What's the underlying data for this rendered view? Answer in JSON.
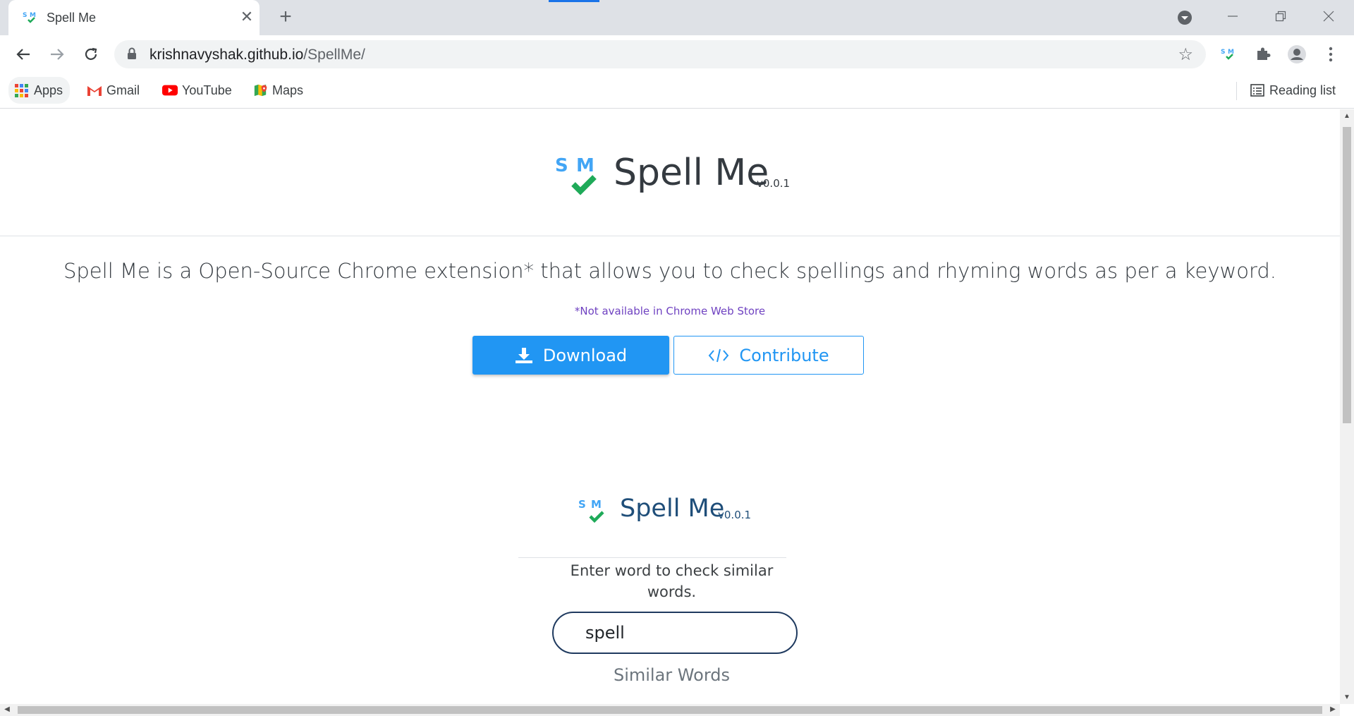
{
  "browser": {
    "tab_title": "Spell Me",
    "tab_close": "✕",
    "new_tab": "+",
    "url_domain": "krishnavyshak.github.io",
    "url_path": "/SpellMe/",
    "bookmarks": [
      {
        "label": "Apps",
        "icon": "apps-grid-icon"
      },
      {
        "label": "Gmail",
        "icon": "gmail-icon"
      },
      {
        "label": "YouTube",
        "icon": "youtube-icon"
      },
      {
        "label": "Maps",
        "icon": "maps-icon"
      }
    ],
    "reading_list": "Reading list"
  },
  "hero": {
    "logo_letters": "SM",
    "title": "Spell Me",
    "version": "v0.0.1"
  },
  "content": {
    "lead": "Spell Me is a Open-Source Chrome extension* that allows you to check spellings and rhyming words as per a keyword.",
    "note": "*Not available in Chrome Web Store",
    "download_label": "Download",
    "contribute_label": "Contribute"
  },
  "demo": {
    "title": "Spell Me",
    "version": "v0.0.1",
    "help": "Enter word to check similar words.",
    "input_value": "spell",
    "similar_heading": "Similar Words"
  },
  "colors": {
    "accent": "#2196f3",
    "logo_blue": "#42a5f5",
    "logo_green": "#1faa59"
  }
}
